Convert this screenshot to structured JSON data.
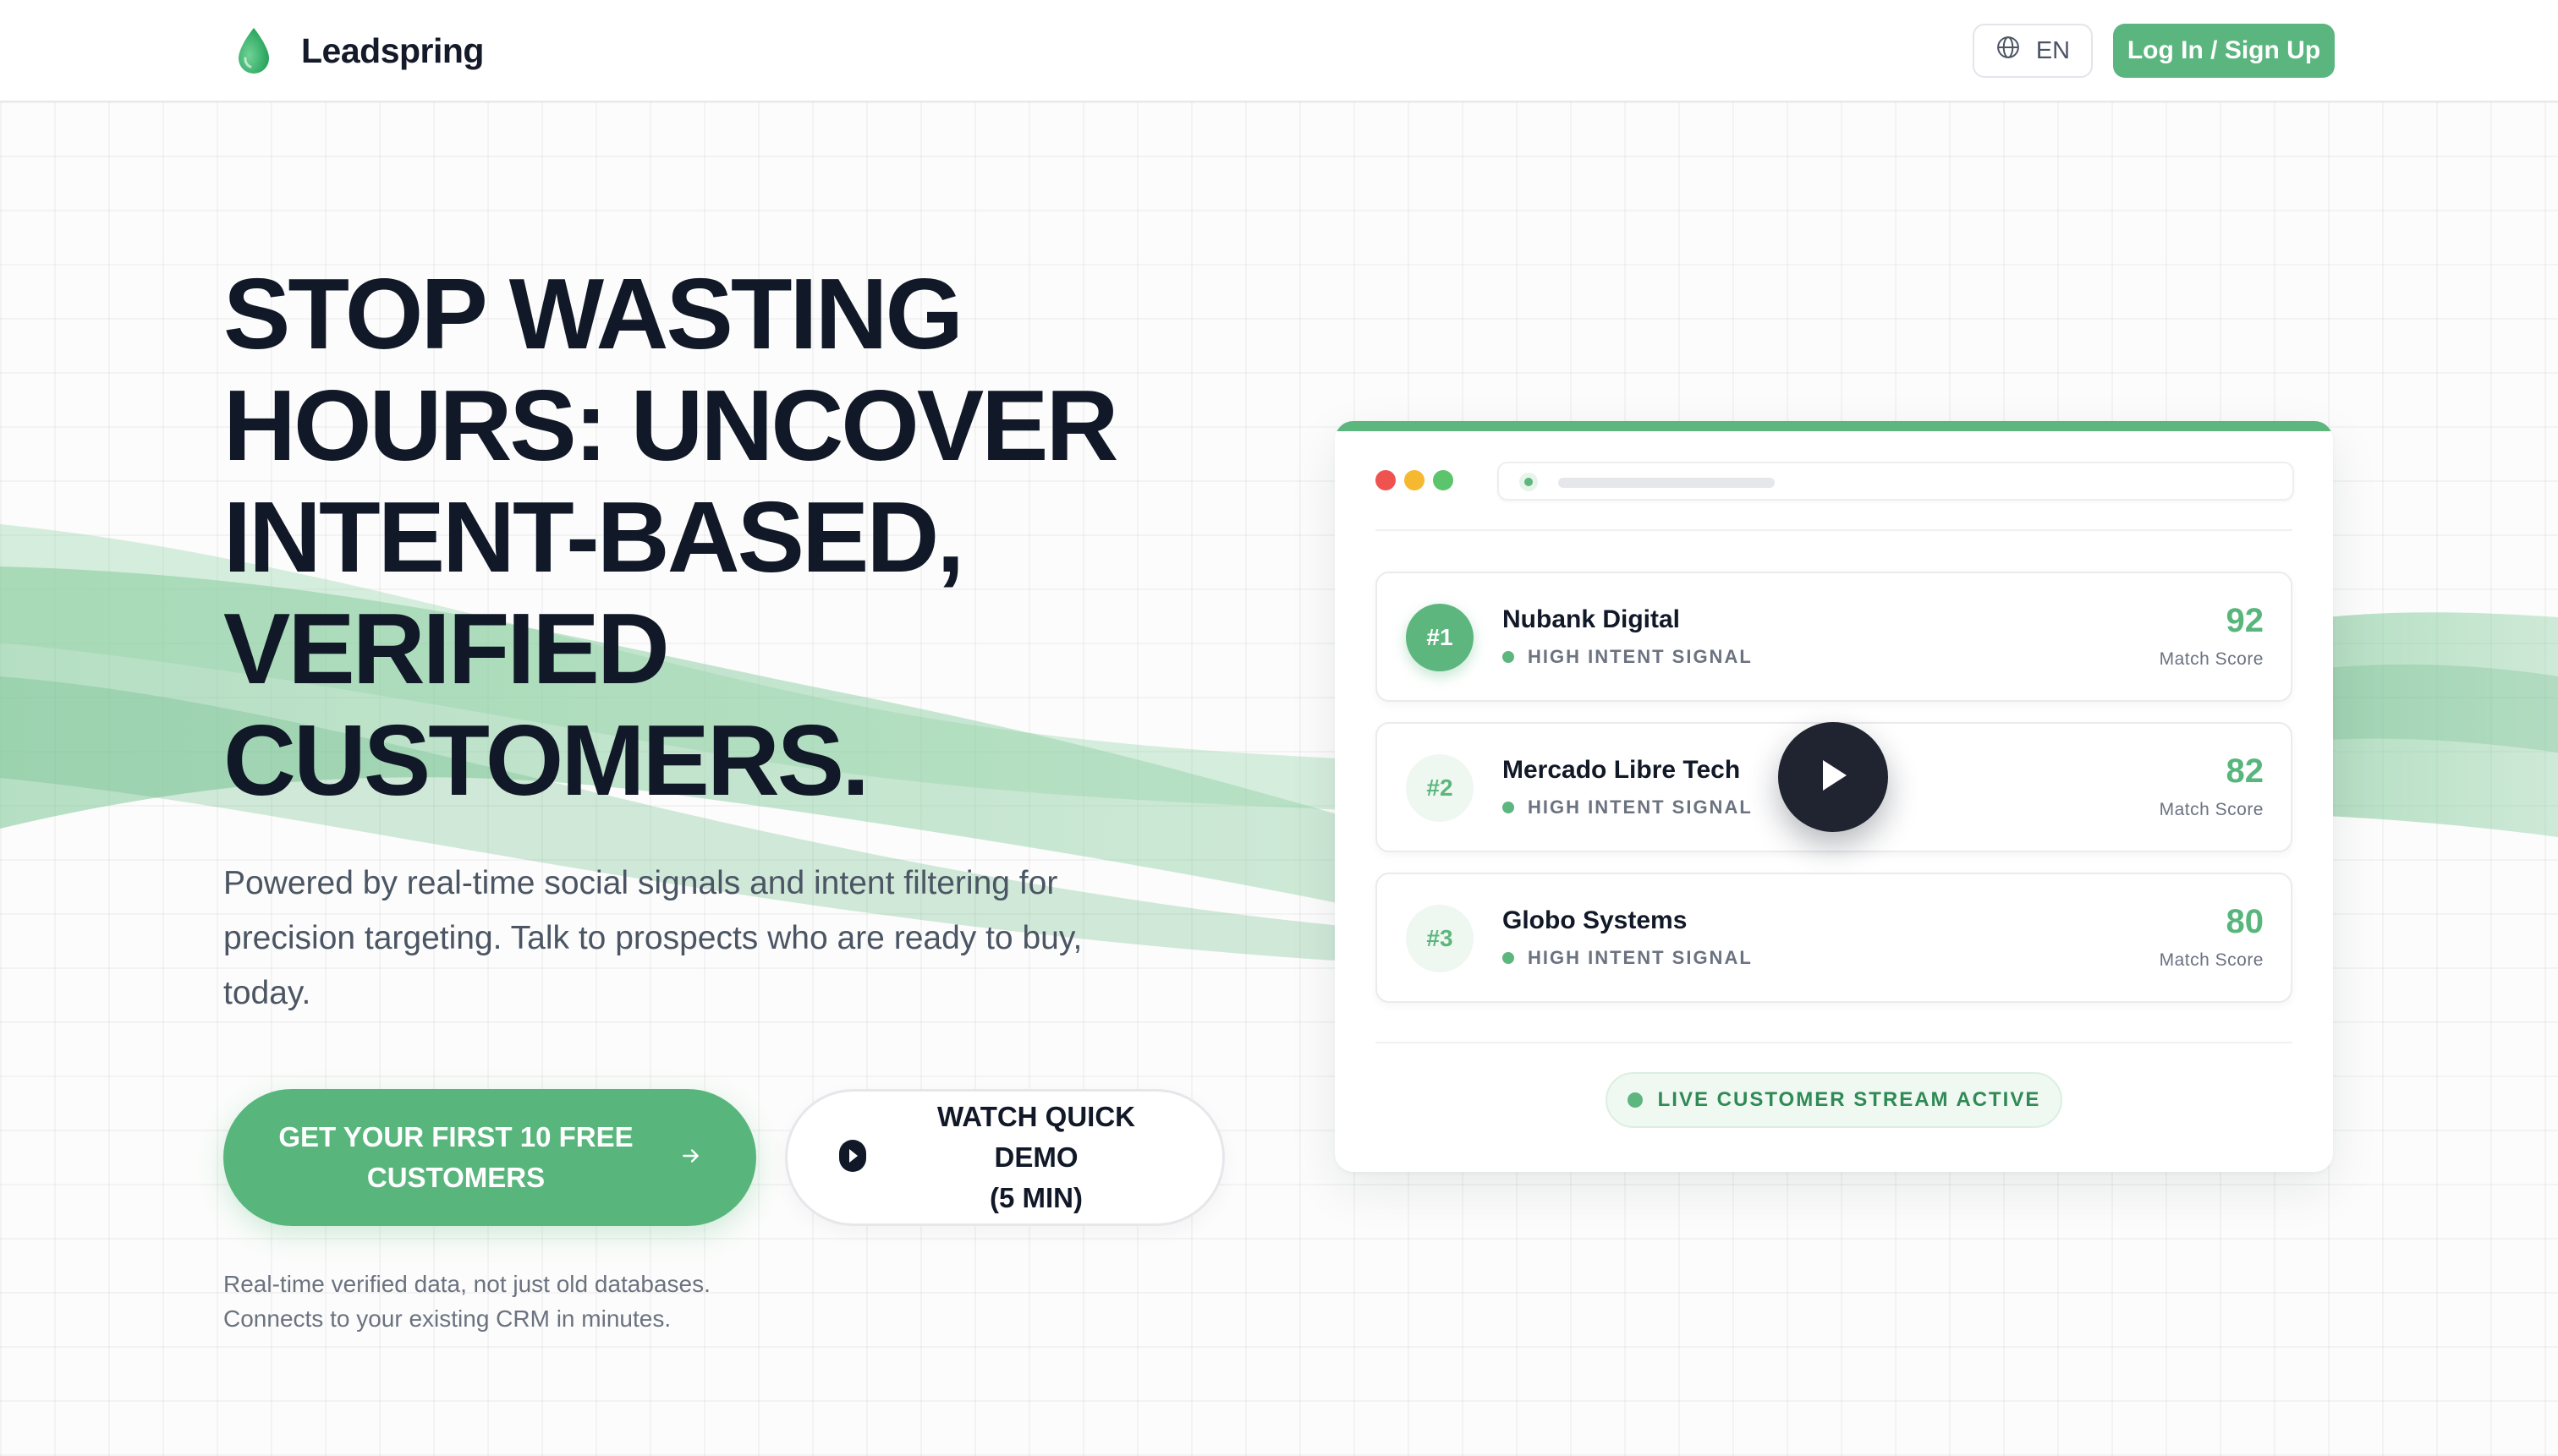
{
  "brand": {
    "name": "Leadspring",
    "accent": "#5ab67e"
  },
  "header": {
    "lang_label": "EN",
    "login_label": "Log In / Sign Up"
  },
  "hero": {
    "title_lines": [
      "STOP WASTING",
      "HOURS: UNCOVER",
      "INTENT-BASED,",
      "VERIFIED",
      "CUSTOMERS."
    ],
    "subtitle_lines": [
      "Powered by real-time social signals and intent filtering for",
      "precision targeting. Talk to prospects who are ready to buy,",
      "today."
    ],
    "cta_primary_lines": [
      "GET YOUR FIRST 10 FREE",
      "CUSTOMERS"
    ],
    "cta_secondary_lines": [
      "WATCH QUICK DEMO",
      "(5 MIN)"
    ],
    "footnote_lines": [
      "Real-time verified data, not just old databases.",
      "Connects to your existing CRM in minutes."
    ]
  },
  "card": {
    "window_dots": [
      "#ef5350",
      "#f5b82e",
      "#5cc46a"
    ],
    "leads": [
      {
        "rank": "#1",
        "name": "Nubank Digital",
        "signal": "HIGH INTENT SIGNAL",
        "score": "92",
        "score_label": "Match Score"
      },
      {
        "rank": "#2",
        "name": "Mercado Libre Tech",
        "signal": "HIGH INTENT SIGNAL",
        "score": "82",
        "score_label": "Match Score"
      },
      {
        "rank": "#3",
        "name": "Globo Systems",
        "signal": "HIGH INTENT SIGNAL",
        "score": "80",
        "score_label": "Match Score"
      }
    ],
    "live_label": "LIVE CUSTOMER STREAM ACTIVE"
  },
  "icons": {
    "logo": "droplet-icon",
    "lang": "globe-icon",
    "cta_primary": "arrow-right-icon",
    "cta_secondary": "play-circle-icon",
    "video": "play-icon"
  }
}
